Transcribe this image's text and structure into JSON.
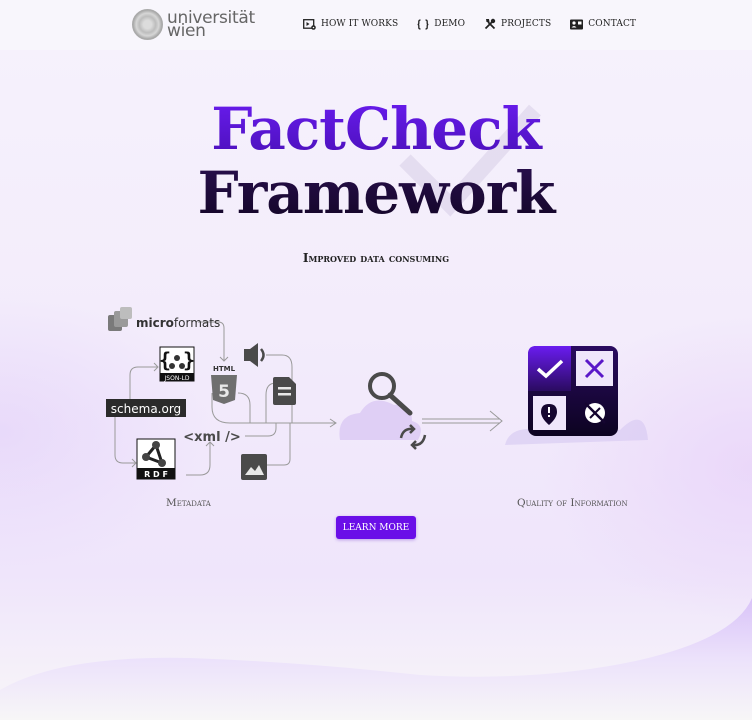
{
  "header": {
    "logo": {
      "line1": "universität",
      "line2": "wien"
    },
    "nav": [
      {
        "label": "HOW IT WORKS",
        "icon": "video-settings-icon"
      },
      {
        "label": "DEMO",
        "icon": "braces-icon"
      },
      {
        "label": "PROJECTS",
        "icon": "tools-icon"
      },
      {
        "label": "CONTACT",
        "icon": "contact-card-icon"
      }
    ]
  },
  "hero": {
    "title_line1": "FactCheck",
    "title_line2": "Framework",
    "subtitle": "Improved data consuming"
  },
  "diagram": {
    "sources": {
      "microformats_bold": "micro",
      "microformats_rest": "formats",
      "jsonld": "JSON-LD",
      "html": "HTML",
      "html_version": "5",
      "schema": "schema.org",
      "xml": "<xml />",
      "rdf": "R D F"
    },
    "left_label": "Metadata",
    "right_label": "Quality of Information"
  },
  "cta": {
    "label": "LEARN MORE"
  },
  "colors": {
    "accent": "#6a0fe8",
    "title_purple": "#5b16e0",
    "title_dark": "#1a0735",
    "icon_gray": "#4a4a4a"
  }
}
